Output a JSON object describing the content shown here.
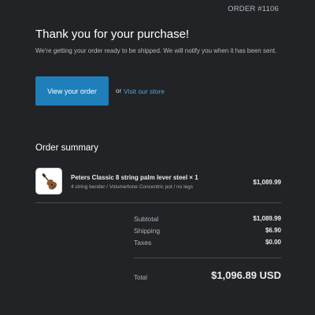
{
  "header": {
    "order_number": "ORDER #1106"
  },
  "confirmation": {
    "title": "Thank you for your purchase!",
    "message": "We're getting your order ready to be shipped. We will notify you when it has been sent."
  },
  "actions": {
    "view_order_label": "View your order",
    "or_text": "or",
    "visit_store_label": "Visit our store"
  },
  "summary": {
    "title": "Order summary",
    "items": [
      {
        "name": "Peters Classic 8 string palm lever steel × 1",
        "variant": "4 string bender / Volume/tone Concentric pot / no legs",
        "price": "$1,089.99",
        "image_icon": "guitar-product-image"
      }
    ]
  },
  "totals": {
    "subtotal_label": "Subtotal",
    "subtotal_value": "$1,089.99",
    "shipping_label": "Shipping",
    "shipping_value": "$6.90",
    "taxes_label": "Taxes",
    "taxes_value": "$0.00",
    "total_label": "Total",
    "total_value": "$1,096.89 USD"
  },
  "colors": {
    "background": "#212326",
    "button": "#1f7fba",
    "link": "#4ba6dc"
  }
}
